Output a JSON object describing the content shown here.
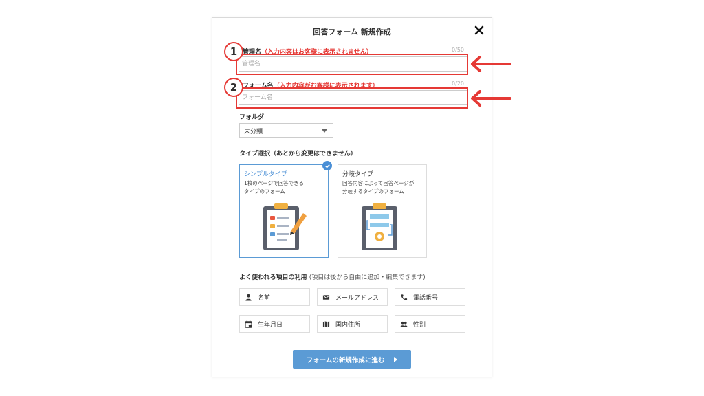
{
  "modal": {
    "title": "回答フォーム 新規作成"
  },
  "field1": {
    "label": "管理名",
    "note": "（入力内容はお客様に表示されません）",
    "counter": "0/50",
    "placeholder": "管理名",
    "badge": "1"
  },
  "field2": {
    "label": "フォーム名",
    "note": "（入力内容がお客様に表示されます）",
    "counter": "0/20",
    "placeholder": "フォーム名",
    "badge": "2"
  },
  "folder": {
    "label": "フォルダ",
    "selected": "未分類"
  },
  "type_select": {
    "label": "タイプ選択（あとから変更はできません）",
    "cards": [
      {
        "title": "シンプルタイプ",
        "desc1": "1枚のページで回答できる",
        "desc2": "タイプのフォーム",
        "selected": true
      },
      {
        "title": "分岐タイプ",
        "desc1": "回答内容によって回答ページが",
        "desc2": "分岐するタイプのフォーム",
        "selected": false
      }
    ]
  },
  "common_items": {
    "label": "よく使われる項目の利用",
    "sub": "(項目は後から自由に追加・編集できます)",
    "chips": [
      {
        "label": "名前",
        "icon": "person-icon"
      },
      {
        "label": "メールアドレス",
        "icon": "envelope-icon"
      },
      {
        "label": "電話番号",
        "icon": "phone-icon"
      },
      {
        "label": "生年月日",
        "icon": "calendar-icon"
      },
      {
        "label": "国内住所",
        "icon": "map-icon"
      },
      {
        "label": "性別",
        "icon": "users-icon"
      }
    ]
  },
  "submit": {
    "label": "フォームの新規作成に進む"
  },
  "colors": {
    "accent": "#5b9bd5",
    "highlight": "#e53935"
  }
}
